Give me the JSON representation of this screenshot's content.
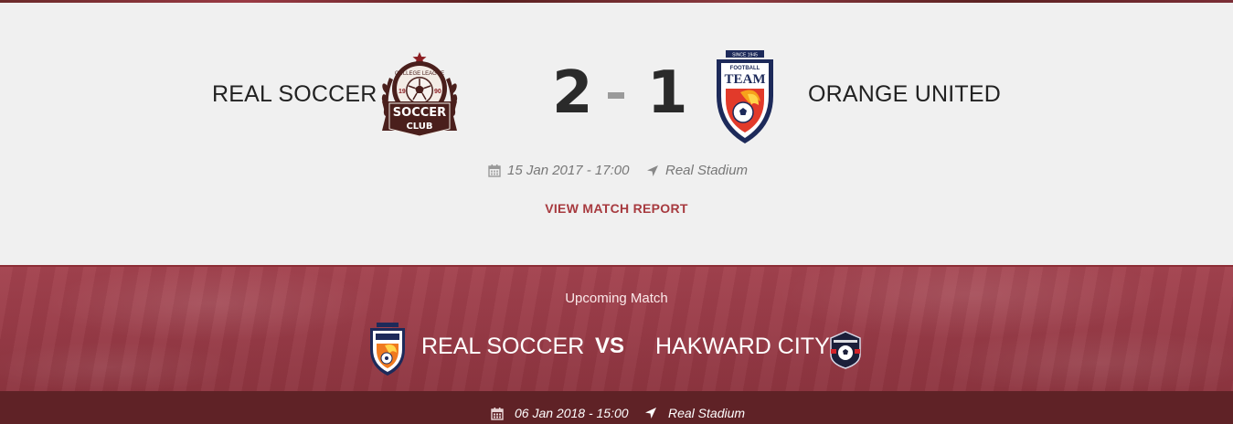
{
  "last_match": {
    "home": {
      "name": "REAL SOCCER",
      "crest": {
        "icon": "soccer-club-crest-icon",
        "top_text": "COLLEGE LEAGUE",
        "year_left": "19",
        "year_right": "90",
        "banner_line1": "SOCCER",
        "banner_line2": "CLUB"
      }
    },
    "away": {
      "name": "ORANGE UNITED",
      "crest": {
        "icon": "football-team-crest-icon",
        "since_text": "SINCE 1945",
        "top_text": "FOOTBALL",
        "banner_text": "TEAM"
      }
    },
    "score_home": "2",
    "score_away": "1",
    "date": "15 Jan 2017 - 17:00",
    "venue": "Real Stadium",
    "report_label": "VIEW MATCH REPORT",
    "date_icon": "calendar-icon",
    "venue_icon": "location-arrow-icon"
  },
  "upcoming": {
    "title": "Upcoming Match",
    "home": {
      "name": "REAL SOCCER",
      "icon": "football-team-crest-icon"
    },
    "vs_label": "VS",
    "away": {
      "name": "HAKWARD CITY",
      "icon": "soccer-club-crest-icon"
    },
    "date": "06 Jan 2018 - 15:00",
    "venue": "Real Stadium"
  },
  "colors": {
    "accent": "#a73a3f",
    "upcoming_bg": "#9a3c48",
    "upcoming_bar": "#5f2226",
    "crest_brown": "#4a1f1c",
    "crest_navy": "#1d2a5a",
    "crest_orange": "#f07a1f"
  }
}
